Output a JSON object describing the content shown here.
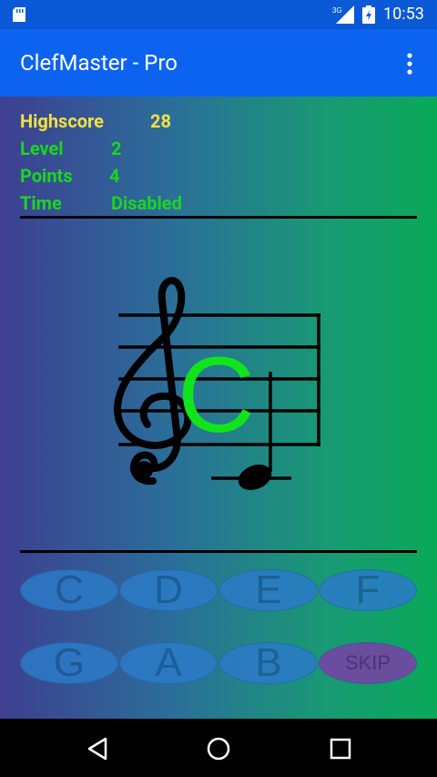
{
  "status_bar": {
    "network": "3G",
    "time": "10:53"
  },
  "app_bar": {
    "title": "ClefMaster - Pro",
    "menu_icon": "more-vert-icon"
  },
  "stats": {
    "highscore_label": "Highscore",
    "highscore_value": "28",
    "level_label": "Level",
    "level_value": "2",
    "points_label": "Points",
    "points_value": "4",
    "time_label": "Time",
    "time_value": "Disabled"
  },
  "staff": {
    "clef": "treble-clef-icon",
    "displayed_note": "C"
  },
  "answer_buttons": [
    "C",
    "D",
    "E",
    "F",
    "G",
    "A",
    "B",
    "SKIP"
  ],
  "colors": {
    "app_bar": "#0b63f0",
    "highscore": "#f2e042",
    "stats": "#1bd61e",
    "note_letter": "#11e41d",
    "button": "#2c7bc8",
    "skip_button": "#7b3fa8"
  }
}
